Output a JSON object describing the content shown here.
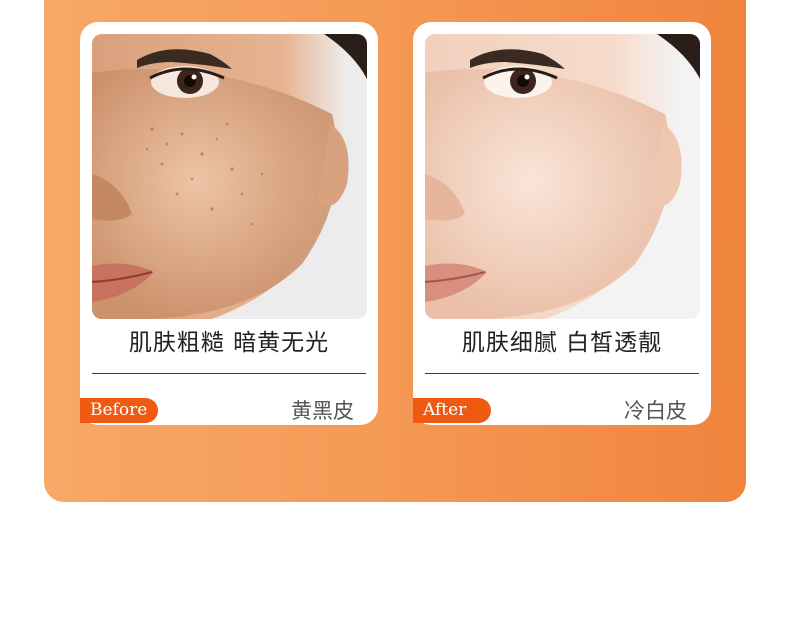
{
  "before": {
    "headline": "肌肤粗糙 暗黄无光",
    "badge": "Before",
    "skin_type": "黄黑皮"
  },
  "after": {
    "headline": "肌肤细腻 白皙透靓",
    "badge": "After",
    "skin_type": "冷白皮"
  },
  "colors": {
    "panel_start": "#f7a867",
    "panel_end": "#f0843c",
    "badge": "#ee5a12"
  }
}
